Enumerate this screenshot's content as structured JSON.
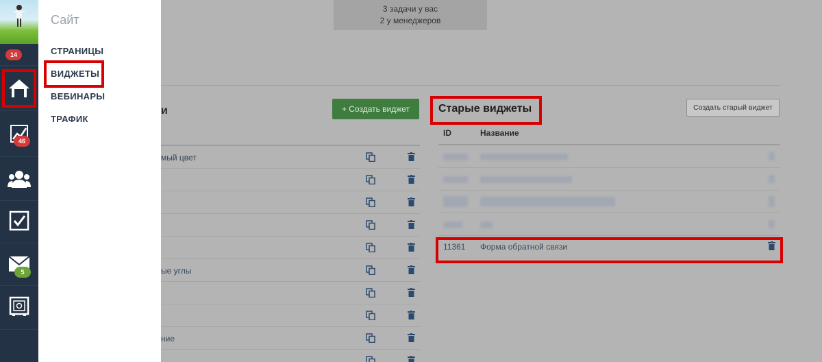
{
  "rail": {
    "badges": {
      "top": "14",
      "stats": "46",
      "mail": "5"
    },
    "icons": [
      "avatar",
      "home-icon",
      "chart-icon",
      "users-icon",
      "checkbox-icon",
      "mail-icon",
      "safe-icon"
    ]
  },
  "menu": {
    "title": "Сайт",
    "items": [
      "СТРАНИЦЫ",
      "ВИДЖЕТЫ",
      "ВЕБИНАРЫ",
      "ТРАФИК"
    ]
  },
  "tasks": {
    "line1": "3 задачи у вас",
    "line2": "2 у менеджеров"
  },
  "widgets": {
    "header_fragment": "и",
    "create_label": "+ Создать виджет",
    "rows": [
      "мый цвет",
      "",
      "",
      "",
      "",
      "ые углы",
      "",
      "",
      "ние",
      ""
    ]
  },
  "old_widgets": {
    "title": "Старые виджеты",
    "create_label": "Создать старый виджет",
    "columns": {
      "id": "ID",
      "name": "Название"
    },
    "highlighted_row": {
      "id": "11361",
      "name": "Форма обратной связи"
    }
  },
  "colors": {
    "highlight": "#d80000",
    "rail": "#233244",
    "create_button": "#3f7d3f"
  }
}
